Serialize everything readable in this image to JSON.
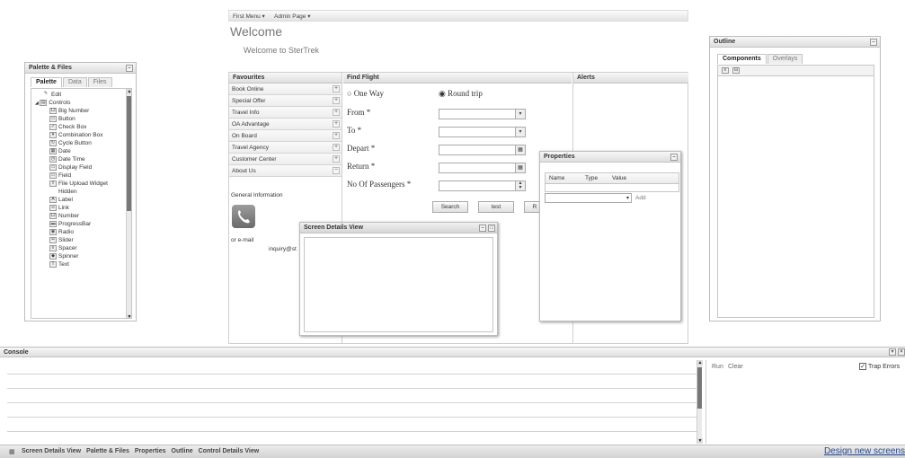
{
  "top_menu": {
    "first_menu": "First Menu ▾",
    "admin_page": "Admin Page ▾"
  },
  "header": {
    "title": "Welcome",
    "subtitle": "Welcome to SterTrek"
  },
  "palette": {
    "title": "Palette & Files",
    "tabs": [
      "Palette",
      "Data",
      "Files"
    ],
    "items": [
      {
        "label": "Edit",
        "icon": "pencil-icon",
        "indent": 1
      },
      {
        "label": "Controls",
        "icon": "folder-icon",
        "indent": 0
      },
      {
        "label": "Big Number",
        "icon": "big-number-icon",
        "indent": 2
      },
      {
        "label": "Button",
        "icon": "button-icon",
        "indent": 2
      },
      {
        "label": "Check Box",
        "icon": "checkbox-icon",
        "indent": 2
      },
      {
        "label": "Combination Box",
        "icon": "combobox-icon",
        "indent": 2
      },
      {
        "label": "Cycle Button",
        "icon": "cycle-button-icon",
        "indent": 2
      },
      {
        "label": "Date",
        "icon": "date-icon",
        "indent": 2
      },
      {
        "label": "Date Time",
        "icon": "date-time-icon",
        "indent": 2
      },
      {
        "label": "Display Field",
        "icon": "display-field-icon",
        "indent": 2
      },
      {
        "label": "Field",
        "icon": "field-icon",
        "indent": 2
      },
      {
        "label": "File Upload Widget",
        "icon": "file-upload-icon",
        "indent": 2
      },
      {
        "label": "Hidden",
        "icon": "hidden-icon",
        "indent": 2
      },
      {
        "label": "Label",
        "icon": "label-icon",
        "indent": 2
      },
      {
        "label": "Link",
        "icon": "link-icon",
        "indent": 2
      },
      {
        "label": "Number",
        "icon": "number-icon",
        "indent": 2
      },
      {
        "label": "ProgressBar",
        "icon": "progressbar-icon",
        "indent": 2
      },
      {
        "label": "Radio",
        "icon": "radio-icon",
        "indent": 2
      },
      {
        "label": "Slider",
        "icon": "slider-icon",
        "indent": 2
      },
      {
        "label": "Spacer",
        "icon": "spacer-icon",
        "indent": 2
      },
      {
        "label": "Spinner",
        "icon": "spinner-icon",
        "indent": 2
      },
      {
        "label": "Text",
        "icon": "text-icon",
        "indent": 2
      }
    ]
  },
  "favourites": {
    "title": "Favourites",
    "items": [
      "Book Online",
      "Special Offer",
      "Travel Info",
      "OA Advantage",
      "On Board",
      "Travel Agency",
      "Customer Center",
      "About Us"
    ],
    "about_us_symbol": "−",
    "other_symbol": "+",
    "general_info": "General Information",
    "or_email": "or e-mail",
    "email_text": "inquiry@st"
  },
  "find_flight": {
    "title": "Find Flight",
    "one_way": "One Way",
    "round_trip": "Round trip",
    "from": "From",
    "to": "To",
    "depart": "Depart",
    "return": "Return",
    "passengers": "No Of Passengers",
    "required_mark": "*",
    "search_button": "Search",
    "test_button": "test",
    "r_button": "R"
  },
  "alerts": {
    "title": "Alerts"
  },
  "properties": {
    "title": "Properties",
    "columns": [
      "Name",
      "Type",
      "Value"
    ],
    "add_label": "Add"
  },
  "screen_details": {
    "title": "Screen Details View"
  },
  "outline": {
    "title": "Outline",
    "tabs": [
      "Components",
      "Overlays"
    ]
  },
  "console": {
    "title": "Console",
    "run_label": "Run",
    "clear_label": "Clear",
    "trap_errors": "Trap Errors",
    "trap_checked": true
  },
  "taskbar": {
    "items": [
      "Screen Details View",
      "Palette & Files",
      "Properties",
      "Outline",
      "Control Details View"
    ],
    "design_link": "Design new screens"
  },
  "colors": {
    "accent_link": "#2a4a8a",
    "panel_border": "#bdbdbd",
    "thumb": "#777777"
  }
}
